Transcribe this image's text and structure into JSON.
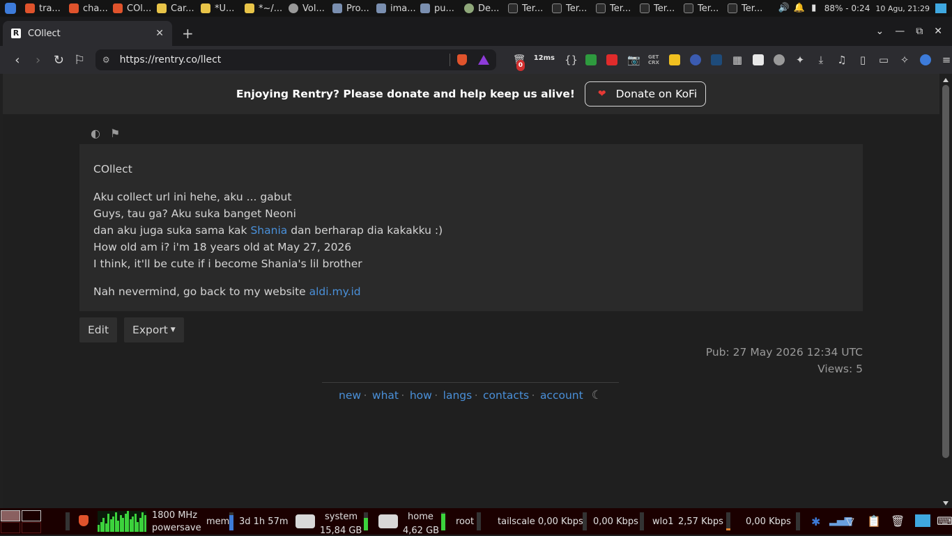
{
  "taskbar": {
    "tasks": [
      {
        "label": "tra...",
        "icon": "brave-icon"
      },
      {
        "label": "cha...",
        "icon": "brave-icon"
      },
      {
        "label": "COl...",
        "icon": "brave-icon"
      },
      {
        "label": "Car...",
        "icon": "note-icon"
      },
      {
        "label": "*U...",
        "icon": "note-icon"
      },
      {
        "label": "*~/...",
        "icon": "note-icon"
      },
      {
        "label": "Vol...",
        "icon": "gray-icon"
      },
      {
        "label": "Pro...",
        "icon": "folder-icon"
      },
      {
        "label": "ima...",
        "icon": "folder-icon"
      },
      {
        "label": "pu...",
        "icon": "folder-icon"
      },
      {
        "label": "De...",
        "icon": "green-icon"
      },
      {
        "label": "Ter...",
        "icon": "terminal-icon"
      },
      {
        "label": "Ter...",
        "icon": "terminal-icon"
      },
      {
        "label": "Ter...",
        "icon": "terminal-icon"
      },
      {
        "label": "Ter...",
        "icon": "terminal-icon"
      },
      {
        "label": "Ter...",
        "icon": "terminal-icon"
      },
      {
        "label": "Ter...",
        "icon": "terminal-icon"
      }
    ],
    "battery": "88% - 0:24",
    "datetime": "10 Agu, 21:29"
  },
  "browser": {
    "tab_title": "COllect",
    "tab_favicon": "R",
    "url": "https://rentry.co/llect",
    "ext_badge_count": "0",
    "ext_ping": "12ms",
    "ext_get_crx": "GET CRX"
  },
  "page": {
    "donate_message": "Enjoying Rentry? Please donate and help keep us alive!",
    "donate_button": "Donate on KoFi",
    "entry": {
      "title": "COllect",
      "line1": "Aku collect url ini hehe, aku ... gabut",
      "line2": "Guys, tau ga? Aku suka banget Neoni",
      "line3_before": "dan aku juga suka sama kak ",
      "line3_link": "Shania",
      "line3_after": " dan berharap dia kakakku :)",
      "line4": "How old am i? i'm 18 years old at May 27, 2026",
      "line5": "I think, it'll be cute if i become Shania's lil brother",
      "line6_before": "Nah nevermind, go back to my website ",
      "line6_link": "aldi.my.id"
    },
    "edit_label": "Edit",
    "export_label": "Export",
    "pub": "Pub: 27 May 2026 12:34 UTC",
    "views": "Views: 5",
    "footer_links": [
      "new",
      "what",
      "how",
      "langs",
      "contacts",
      "account"
    ]
  },
  "panel": {
    "cpu_freq": "1800 MHz",
    "cpu_gov": "powersave",
    "mem_label": "mem",
    "uptime": "3d 1h 57m",
    "system_label": "system",
    "system_size": "15,84 GB",
    "home_label": "home",
    "home_size": "4,62 GB",
    "root_label": "root",
    "tailscale": "tailscale 0,00 Kbps",
    "tailscale_up": "0,00 Kbps",
    "wlo1": "wlo1",
    "wlo1_down": "2,57 Kbps",
    "wlo1_up": "0,00 Kbps"
  },
  "colors": {
    "link": "#4a90d9",
    "panel_bg": "#1b0000",
    "page_bg": "#1f1f1f"
  }
}
